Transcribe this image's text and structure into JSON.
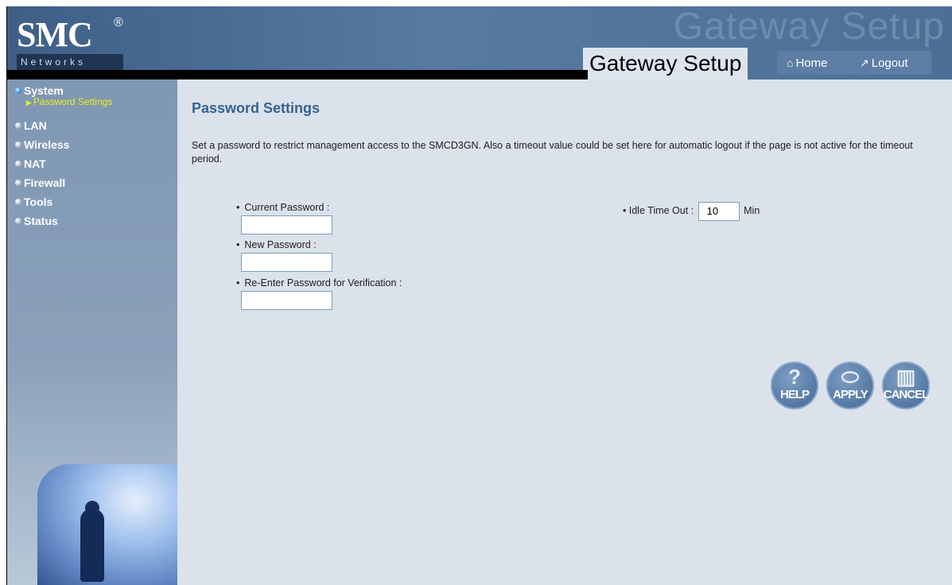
{
  "header": {
    "logo_text": "SMC",
    "logo_registered": "®",
    "logo_sub": "Networks",
    "watermark": "Gateway Setup",
    "title": "Gateway Setup",
    "nav": {
      "home": "Home",
      "logout": "Logout"
    }
  },
  "sidebar": {
    "items": [
      {
        "label": "System",
        "active": true
      },
      {
        "label": "LAN"
      },
      {
        "label": "Wireless"
      },
      {
        "label": "NAT"
      },
      {
        "label": "Firewall"
      },
      {
        "label": "Tools"
      },
      {
        "label": "Status"
      }
    ],
    "sub_item": "Password Settings"
  },
  "content": {
    "title": "Password Settings",
    "description": "Set a password to restrict management access to the SMCD3GN. Also a timeout value could be set here for automatic logout if the page is not active for the timeout period.",
    "fields": {
      "current": "Current Password :",
      "new": "New Password :",
      "reenter": "Re-Enter Password for Verification :"
    },
    "idle": {
      "label": "Idle Time Out :",
      "value": "10",
      "unit": "Min"
    },
    "buttons": {
      "help": "HELP",
      "apply": "APPLY",
      "cancel": "CANCEL"
    }
  },
  "colors": {
    "title": "#34628f",
    "submenu_active": "#e7ee22",
    "header_blue": "#567aa2"
  }
}
